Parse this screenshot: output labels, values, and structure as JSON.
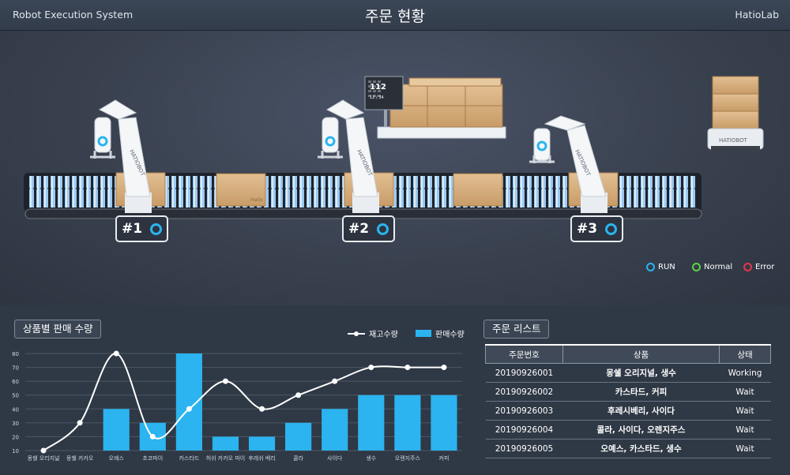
{
  "header": {
    "left": "Robot Execution System",
    "title": "주문 현황",
    "right": "HatioLab"
  },
  "robots": [
    {
      "label": "#1",
      "status": "RUN"
    },
    {
      "label": "#2",
      "status": "RUN"
    },
    {
      "label": "#3",
      "status": "RUN"
    }
  ],
  "robot_brand": "HATIOBOT",
  "box_brand": "Hatio",
  "display": {
    "big": "112",
    "small": "12 / 34"
  },
  "legend": [
    {
      "label": "RUN",
      "color": "#2bb4ef"
    },
    {
      "label": "Normal",
      "color": "#5fd04a"
    },
    {
      "label": "Error",
      "color": "#e8344b"
    }
  ],
  "colors": {
    "bar": "#2bb4ef",
    "line": "#ffffff",
    "run": "#2bb4ef"
  },
  "chart_panel": {
    "title": "상품별 판매 수량",
    "legend_line": "재고수량",
    "legend_bar": "판매수량"
  },
  "chart_data": {
    "type": "bar",
    "categories": [
      "몽쉘 오리지널",
      "몽쉘 카카오",
      "오예스",
      "초코파이",
      "카스타드",
      "허쉬 카카오 파이",
      "후레쉬 베리",
      "콜라",
      "사이다",
      "생수",
      "오렌지주스",
      "커피"
    ],
    "series": [
      {
        "name": "판매수량",
        "type": "bar",
        "values": [
          0,
          0,
          40,
          30,
          80,
          20,
          20,
          30,
          40,
          50,
          50,
          50
        ]
      },
      {
        "name": "재고수량",
        "type": "line",
        "values": [
          10,
          30,
          80,
          20,
          40,
          60,
          40,
          50,
          60,
          70,
          70,
          70
        ]
      }
    ],
    "yticks": [
      10,
      20,
      30,
      40,
      50,
      60,
      70,
      80
    ],
    "ylim": [
      10,
      80
    ],
    "grid": true,
    "legend": "top-right"
  },
  "orders_panel": {
    "title": "주문 리스트",
    "columns": [
      "주문번호",
      "상품",
      "상태"
    ],
    "rows": [
      {
        "id": "20190926001",
        "product": "몽쉘 오리지널, 생수",
        "status": "Working"
      },
      {
        "id": "20190926002",
        "product": "카스타드, 커피",
        "status": "Wait"
      },
      {
        "id": "20190926003",
        "product": "후레시베리, 사이다",
        "status": "Wait"
      },
      {
        "id": "20190926004",
        "product": "콜라, 사이다, 오렌지주스",
        "status": "Wait"
      },
      {
        "id": "20190926005",
        "product": "오예스, 카스타드, 생수",
        "status": "Wait"
      }
    ]
  }
}
